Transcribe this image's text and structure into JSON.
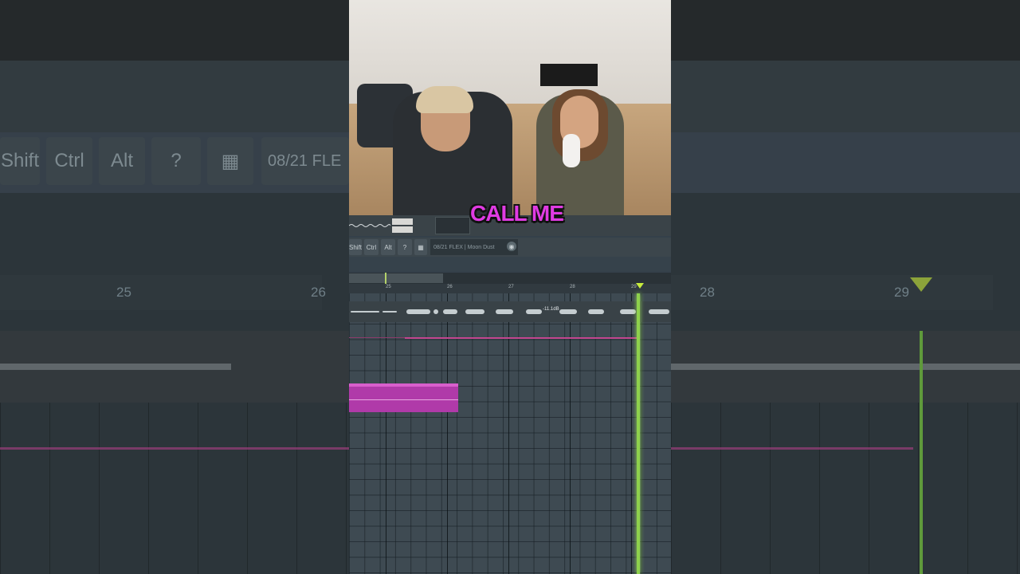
{
  "caption": "CALL ME",
  "toolbar": {
    "keys": [
      "Shift",
      "Ctrl",
      "Alt"
    ],
    "hint_text": "08/21  FLEX | Moon Dust"
  },
  "timeline": {
    "bars": [
      "25",
      "26",
      "27",
      "28",
      "29"
    ],
    "db_readout": "-11.1dB"
  },
  "side_blur": {
    "keys": [
      "Shift",
      "Ctrl",
      "Alt"
    ],
    "hint_text": "08/21  FLE",
    "ruler_left": [
      "25",
      "26"
    ],
    "ruler_right": [
      "28",
      "29"
    ]
  },
  "colors": {
    "caption": "#e03be3",
    "playhead": "#8ed14c",
    "pattern": "#b03aa9",
    "automation": "#c2468f",
    "marker": "#c7ec3d"
  },
  "icons": [
    "help-icon",
    "cart-icon",
    "globe-icon",
    "song-marker-icon"
  ]
}
